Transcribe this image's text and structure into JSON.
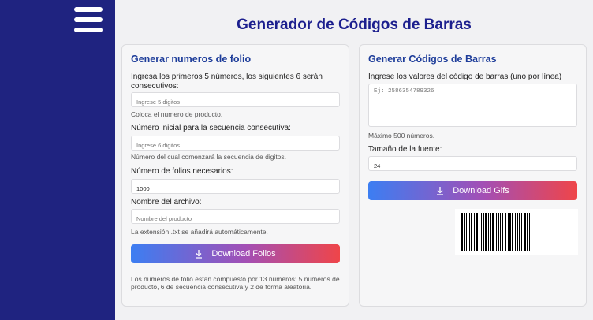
{
  "app": {
    "title": "Generador de Códigos de Barras"
  },
  "sidebar": {
    "menu_icon": "hamburger-menu-icon"
  },
  "folios": {
    "title": "Generar numeros de folio",
    "field1": {
      "label": "Ingresa los primeros 5 números, los siguientes 6 serán consecutivos:",
      "placeholder": "Ingrese 5 digitos",
      "help": "Coloca el numero de producto."
    },
    "field2": {
      "label": "Número inicial para la secuencia consecutiva:",
      "placeholder": "Ingrese 6 digitos",
      "help": "Número del cual comenzará la secuencia de digitos."
    },
    "field3": {
      "label": "Número de folios necesarios:",
      "value": "1000"
    },
    "field4": {
      "label": "Nombre del archivo:",
      "placeholder": "Nombre del producto",
      "help": "La extensión .txt se añadirá automáticamente."
    },
    "button": {
      "label": "Download Folios",
      "icon": "download-icon"
    },
    "note": "Los numeros de folio estan compuesto por 13 numeros: 5 numeros de producto, 6 de secuencia consecutiva y 2 de forma aleatoria."
  },
  "barcodes": {
    "title": "Generar Códigos de Barras",
    "values_field": {
      "label": "Ingrese los valores del código de barras (uno por línea)",
      "placeholder": "Ej: 2586354789326",
      "help": "Máximo 500 números."
    },
    "font_field": {
      "label": "Tamaño de la fuente:",
      "value": "24"
    },
    "button": {
      "label": "Download Gifs",
      "icon": "download-icon"
    }
  },
  "colors": {
    "sidebar": "#1f2380",
    "title": "#1c1f8e",
    "card_title": "#1e3d9a",
    "gradient_start": "#3c7ef2",
    "gradient_end": "#ef4549"
  }
}
